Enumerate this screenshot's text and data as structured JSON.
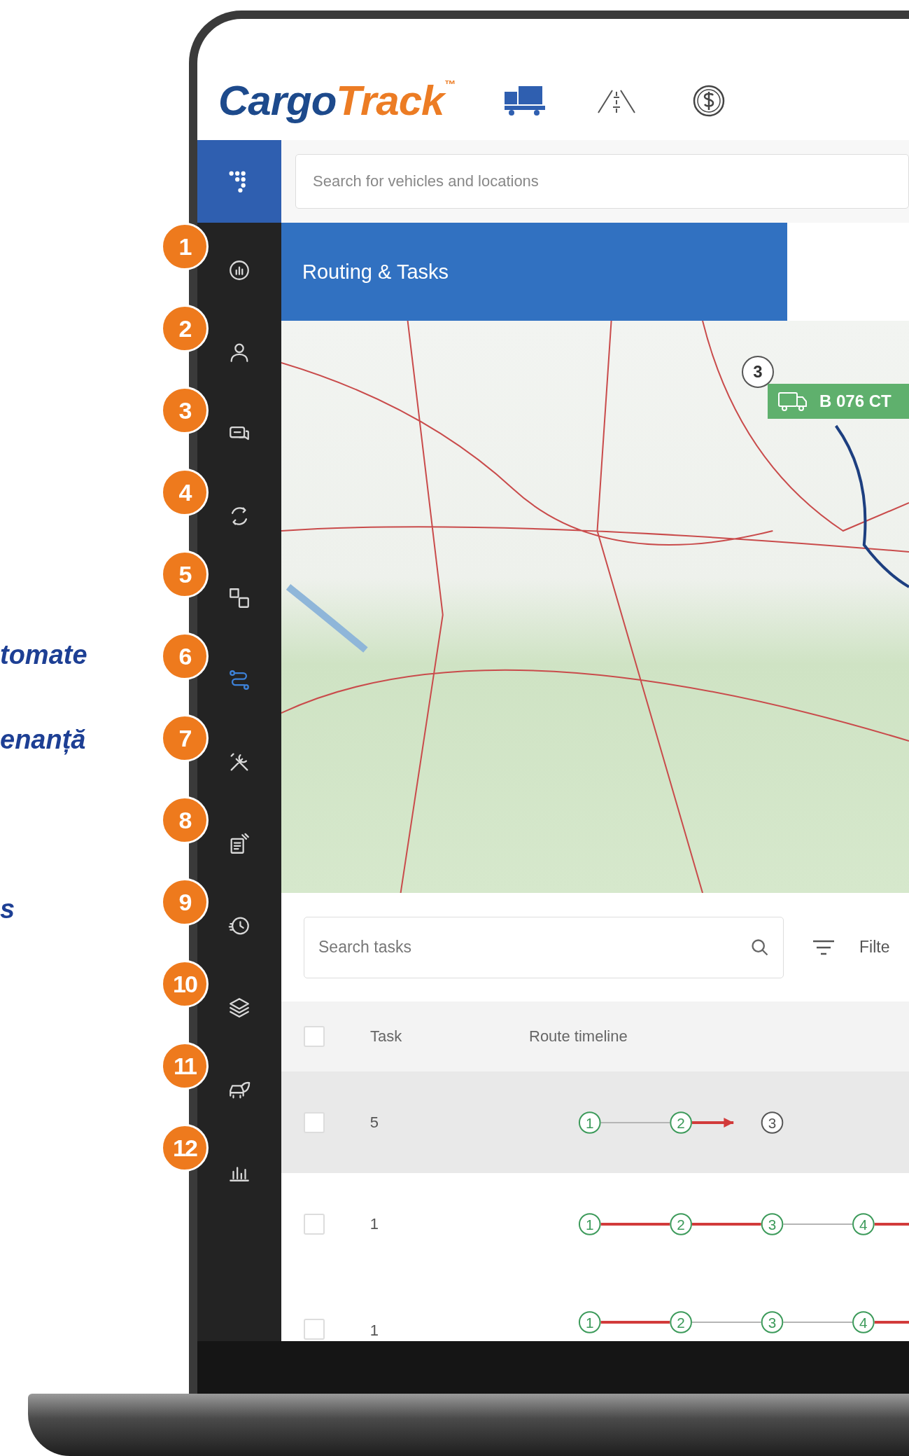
{
  "side_captions": [
    "tomate",
    "enanță",
    "s"
  ],
  "logo": {
    "primary": "Cargo",
    "accent": "Track",
    "mark": "™"
  },
  "header_modules": [
    {
      "kind": "trucks",
      "selected": true
    },
    {
      "kind": "road",
      "selected": false
    },
    {
      "kind": "money",
      "selected": false
    }
  ],
  "global_search": {
    "placeholder": "Search for vehicles and locations"
  },
  "sidebar": {
    "items": [
      {
        "badge": "1",
        "kind": "gauge",
        "selected": false
      },
      {
        "badge": "2",
        "kind": "person",
        "selected": false
      },
      {
        "badge": "3",
        "kind": "chat",
        "selected": false
      },
      {
        "badge": "4",
        "kind": "cycle",
        "selected": false
      },
      {
        "badge": "5",
        "kind": "tiles",
        "selected": false
      },
      {
        "badge": "6",
        "kind": "route",
        "selected": true
      },
      {
        "badge": "7",
        "kind": "tools",
        "selected": false
      },
      {
        "badge": "8",
        "kind": "documents",
        "selected": false
      },
      {
        "badge": "9",
        "kind": "history",
        "selected": false
      },
      {
        "badge": "10",
        "kind": "layers",
        "selected": false
      },
      {
        "badge": "11",
        "kind": "car",
        "selected": false
      },
      {
        "badge": "12",
        "kind": "bars",
        "selected": false
      }
    ]
  },
  "page_title": "Routing & Tasks",
  "map": {
    "cluster": "3",
    "vehicle": "B 076 CT"
  },
  "task_search": {
    "placeholder": "Search tasks"
  },
  "filter": {
    "label": "Filte"
  },
  "table": {
    "columns": [
      "Task",
      "Route timeline"
    ],
    "rows": [
      {
        "selected": true,
        "checked": false,
        "task": "5",
        "stops": [
          {
            "label": "1",
            "reached": true
          },
          {
            "label": "2",
            "reached": true
          },
          {
            "label": "3",
            "reached": false
          }
        ],
        "legs": [
          {
            "delayed": false,
            "in_progress": false
          },
          {
            "delayed": true,
            "in_progress": true
          }
        ]
      },
      {
        "selected": false,
        "checked": false,
        "task": "1",
        "stops": [
          {
            "label": "1",
            "reached": true
          },
          {
            "label": "2",
            "reached": true
          },
          {
            "label": "3",
            "reached": true
          },
          {
            "label": "4",
            "reached": true
          }
        ],
        "legs": [
          {
            "delayed": true,
            "in_progress": false
          },
          {
            "delayed": true,
            "in_progress": false
          },
          {
            "delayed": false,
            "in_progress": false
          },
          {
            "delayed": true,
            "in_progress": false
          }
        ]
      },
      {
        "selected": false,
        "checked": false,
        "task": "1",
        "stops": [
          {
            "label": "1",
            "reached": true
          },
          {
            "label": "2",
            "reached": true
          },
          {
            "label": "3",
            "reached": true
          },
          {
            "label": "4",
            "reached": true
          }
        ],
        "legs": [
          {
            "delayed": true,
            "in_progress": false
          },
          {
            "delayed": false,
            "in_progress": false
          },
          {
            "delayed": false,
            "in_progress": false
          },
          {
            "delayed": true,
            "in_progress": false
          }
        ]
      }
    ],
    "select_all_checked": false
  }
}
